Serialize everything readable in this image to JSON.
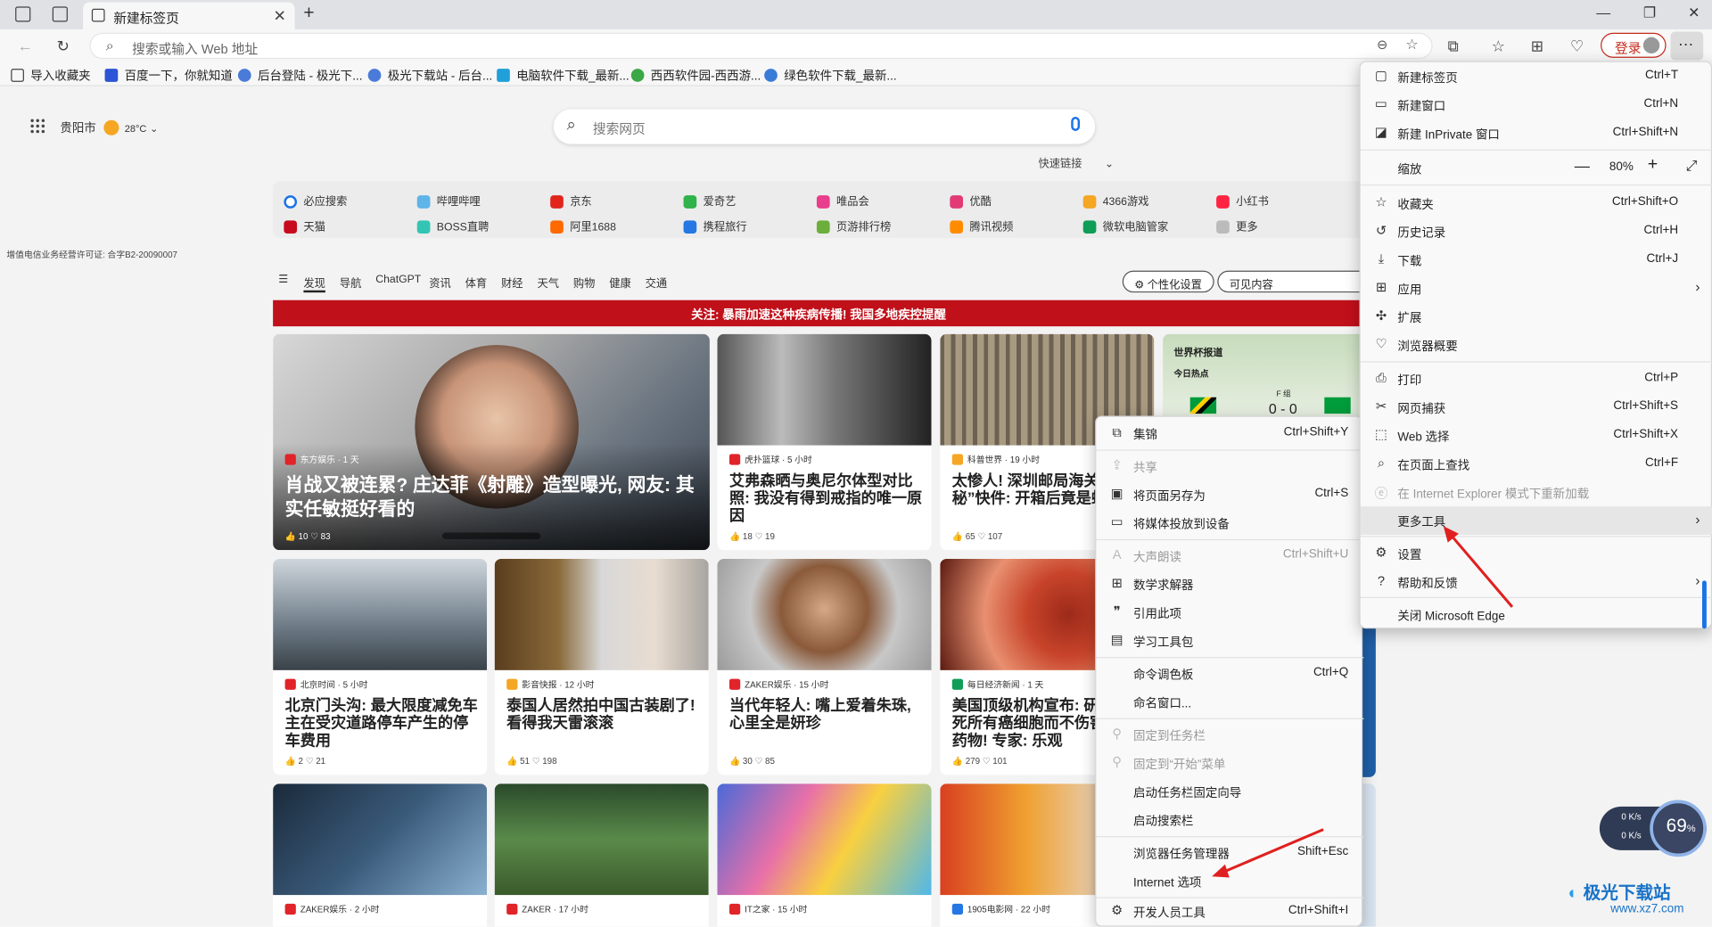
{
  "tab": {
    "title": "新建标签页"
  },
  "address": {
    "placeholder": "搜索或输入 Web 地址"
  },
  "toolbar": {
    "login": "登录"
  },
  "favorites": [
    "导入收藏夹",
    "百度一下，你就知道",
    "后台登陆 - 极光下...",
    "极光下载站 - 后台...",
    "电脑软件下载_最新...",
    "西西软件园-西西游...",
    "绿色软件下载_最新..."
  ],
  "page": {
    "location": "贵阳市",
    "temp": "28°C",
    "search_placeholder": "搜索网页",
    "quick_links_label": "快速链接",
    "license": "增值电信业务经营许可证: 合字B2-20090007",
    "quick_links": [
      [
        "必应搜索",
        "哔哩哔哩",
        "京东",
        "爱奇艺",
        "唯品会",
        "优酷",
        "4366游戏",
        "小红书"
      ],
      [
        "天猫",
        "BOSS直聘",
        "阿里1688",
        "携程旅行",
        "页游排行榜",
        "腾讯视频",
        "微软电脑管家",
        "更多"
      ]
    ],
    "nav": [
      "发现",
      "导航",
      "ChatGPT",
      "资讯",
      "体育",
      "财经",
      "天气",
      "购物",
      "健康",
      "交通"
    ],
    "personalize": "个性化设置",
    "visible_content": "可见内容",
    "banner": "关注: 暴雨加速这种疾病传播! 我国多地疾控提醒"
  },
  "feed": {
    "hero": {
      "source": "东方娱乐 · 1 天",
      "title": "肖战又被连累? 庄达菲《射雕》造型曝光, 网友: 其实任敏挺好看的",
      "likes": "10",
      "comments": "83"
    },
    "cards": [
      {
        "source": "虎扑篮球 · 5 小时",
        "title": "艾弗森晒与奥尼尔体型对比照: 我没有得到戒指的唯一原因",
        "likes": "18",
        "comments": "19"
      },
      {
        "source": "科普世界 · 19 小时",
        "title": "太惨人! 深圳邮局海关 “神秘”快件: 开箱后竟是蜈蚣",
        "likes": "65",
        "comments": "107"
      },
      {
        "source": "北京时间 · 5 小时",
        "title": "北京门头沟: 最大限度减免车主在受灾道路停车产生的停车费用",
        "likes": "2",
        "comments": "21"
      },
      {
        "source": "影音快报 · 12 小时",
        "title": "泰国人居然拍中国古装剧了! 看得我天雷滚滚",
        "likes": "51",
        "comments": "198"
      },
      {
        "source": "ZAKER娱乐 · 15 小时",
        "title": "当代年轻人: 嘴上爱着朱珠, 心里全是妍珍",
        "likes": "30",
        "comments": "85"
      },
      {
        "source": "每日经济新闻 · 1 天",
        "title": "美国顶级机构宣布: 研发 杀死所有癌细胞而不伤害 胞的药物! 专家: 乐观",
        "likes": "279",
        "comments": "101"
      }
    ],
    "bottom_sources": [
      "ZAKER娱乐 · 2 小时",
      "ZAKER · 17 小时",
      "IT之家 · 15 小时",
      "1905电影网 · 22 小时"
    ],
    "worldcup": {
      "title": "世界杯报道",
      "hot": "今日热点",
      "group": "F 组",
      "score": "0 - 0"
    }
  },
  "menu": {
    "items": [
      {
        "label": "新建标签页",
        "shortcut": "Ctrl+T",
        "icon": "new-tab-icon"
      },
      {
        "label": "新建窗口",
        "shortcut": "Ctrl+N",
        "icon": "new-window-icon"
      },
      {
        "label": "新建 InPrivate 窗口",
        "shortcut": "Ctrl+Shift+N",
        "icon": "inprivate-icon"
      },
      {
        "label": "缩放",
        "shortcut": "",
        "icon": ""
      },
      {
        "label": "收藏夹",
        "shortcut": "Ctrl+Shift+O",
        "icon": "favorites-icon"
      },
      {
        "label": "历史记录",
        "shortcut": "Ctrl+H",
        "icon": "history-icon"
      },
      {
        "label": "下载",
        "shortcut": "Ctrl+J",
        "icon": "download-icon"
      },
      {
        "label": "应用",
        "shortcut": "",
        "icon": "apps-icon"
      },
      {
        "label": "扩展",
        "shortcut": "",
        "icon": "extensions-icon"
      },
      {
        "label": "浏览器概要",
        "shortcut": "",
        "icon": "essentials-icon"
      },
      {
        "label": "打印",
        "shortcut": "Ctrl+P",
        "icon": "print-icon"
      },
      {
        "label": "网页捕获",
        "shortcut": "Ctrl+Shift+S",
        "icon": "capture-icon"
      },
      {
        "label": "Web 选择",
        "shortcut": "Ctrl+Shift+X",
        "icon": "web-select-icon"
      },
      {
        "label": "在页面上查找",
        "shortcut": "Ctrl+F",
        "icon": "find-icon"
      },
      {
        "label": "在 Internet Explorer 模式下重新加载",
        "shortcut": "",
        "icon": "ie-icon"
      },
      {
        "label": "更多工具",
        "shortcut": "",
        "icon": ""
      },
      {
        "label": "设置",
        "shortcut": "",
        "icon": "settings-icon"
      },
      {
        "label": "帮助和反馈",
        "shortcut": "",
        "icon": "help-icon"
      },
      {
        "label": "关闭 Microsoft Edge",
        "shortcut": "",
        "icon": ""
      }
    ],
    "zoom": "80%"
  },
  "submenu": {
    "items": [
      {
        "label": "集锦",
        "shortcut": "Ctrl+Shift+Y"
      },
      {
        "label": "共享",
        "shortcut": ""
      },
      {
        "label": "将页面另存为",
        "shortcut": "Ctrl+S"
      },
      {
        "label": "将媒体投放到设备",
        "shortcut": ""
      },
      {
        "label": "大声朗读",
        "shortcut": "Ctrl+Shift+U"
      },
      {
        "label": "数学求解器",
        "shortcut": ""
      },
      {
        "label": "引用此项",
        "shortcut": ""
      },
      {
        "label": "学习工具包",
        "shortcut": ""
      },
      {
        "label": "命令调色板",
        "shortcut": "Ctrl+Q"
      },
      {
        "label": "命名窗口...",
        "shortcut": ""
      },
      {
        "label": "固定到任务栏",
        "shortcut": ""
      },
      {
        "label": "固定到“开始”菜单",
        "shortcut": ""
      },
      {
        "label": "启动任务栏固定向导",
        "shortcut": ""
      },
      {
        "label": "启动搜索栏",
        "shortcut": ""
      },
      {
        "label": "浏览器任务管理器",
        "shortcut": "Shift+Esc"
      },
      {
        "label": "Internet 选项",
        "shortcut": ""
      },
      {
        "label": "开发人员工具",
        "shortcut": "Ctrl+Shift+I"
      }
    ]
  },
  "gauge": {
    "percent": "69",
    "unit": "%",
    "up": "0 K/s",
    "down": "0 K/s"
  },
  "watermark": {
    "name": "极光下载站",
    "url": "www.xz7.com"
  }
}
